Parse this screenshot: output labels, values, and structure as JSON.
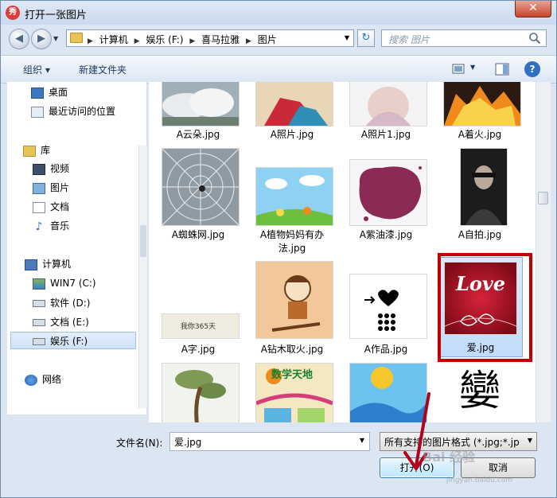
{
  "window": {
    "title": "打开一张图片",
    "app_icon_text": "秀",
    "close_symbol": "✕"
  },
  "nav": {
    "back_symbol": "◀",
    "forward_symbol": "▶",
    "refresh_symbol": "↻"
  },
  "address": {
    "crumbs": [
      "计算机",
      "娱乐 (F:)",
      "喜马拉雅",
      "图片"
    ]
  },
  "search": {
    "placeholder": "搜索 图片"
  },
  "toolbar": {
    "organize_label": "组织 ▾",
    "new_folder_label": "新建文件夹",
    "help_symbol": "?"
  },
  "sidebar": {
    "items": [
      {
        "label": "桌面",
        "icon": "desktop-icon"
      },
      {
        "label": "最近访问的位置",
        "icon": "recent-places-icon"
      },
      {
        "label": "库",
        "icon": "library-icon"
      },
      {
        "label": "视频",
        "icon": "video-icon"
      },
      {
        "label": "图片",
        "icon": "pictures-icon"
      },
      {
        "label": "文档",
        "icon": "documents-icon"
      },
      {
        "label": "音乐",
        "icon": "music-icon"
      },
      {
        "label": "计算机",
        "icon": "computer-icon"
      },
      {
        "label": "WIN7 (C:)",
        "icon": "drive-c-icon"
      },
      {
        "label": "软件 (D:)",
        "icon": "drive-d-icon"
      },
      {
        "label": "文档 (E:)",
        "icon": "drive-e-icon"
      },
      {
        "label": "娱乐 (F:)",
        "icon": "drive-f-icon"
      },
      {
        "label": "网络",
        "icon": "network-icon"
      }
    ]
  },
  "files": {
    "row0": [
      "A云朵.jpg",
      "A照片.jpg",
      "A照片1.jpg",
      "A着火.jpg"
    ],
    "row1": [
      "A蜘蛛网.jpg",
      "A植物妈妈有办",
      "法.jpg",
      "A紫油漆.jpg",
      "A自拍.jpg"
    ],
    "row2": [
      "A字.jpg",
      "A钻木取火.jpg",
      "A作品.jpg",
      "爱.jpg"
    ],
    "selected": "爱.jpg",
    "thumb_text": {
      "love": "Love",
      "word_card": "我你365天",
      "ai_char": "孌",
      "poster": "数学天地"
    }
  },
  "bottom": {
    "filename_label": "文件名(N):",
    "filename_value": "爱.jpg",
    "filetype_value": "所有支持的图片格式 (*.jpg;*.jp",
    "open_label": "打开(O)",
    "cancel_label": "取消"
  },
  "watermark": {
    "text": "Bai 经验",
    "sub": "jingyan.baidu.com"
  }
}
